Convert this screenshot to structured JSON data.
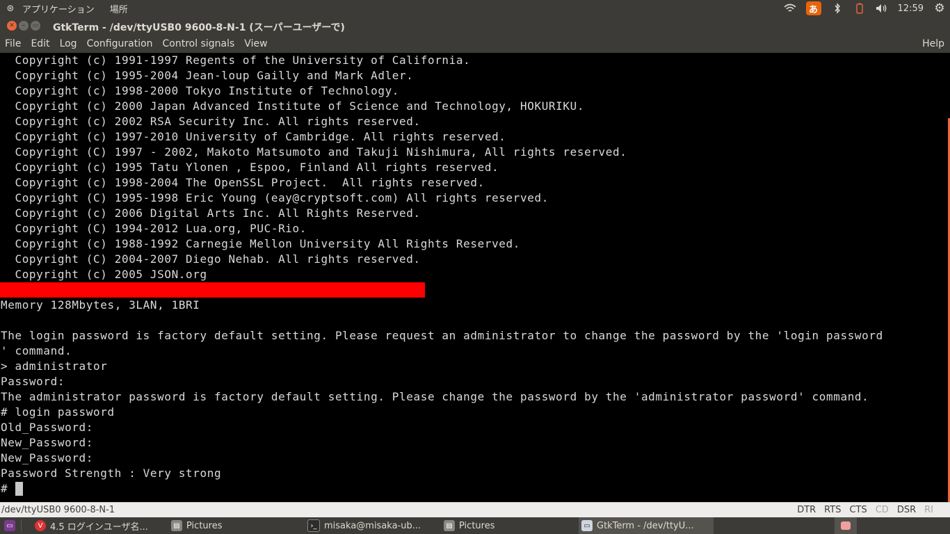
{
  "top_panel": {
    "apps_label": "アプリケーション",
    "places_label": "場所",
    "ime_label": "あ",
    "clock": "12:59"
  },
  "window": {
    "title": "GtkTerm - /dev/ttyUSB0  9600-8-N-1 (スーパーユーザーで)"
  },
  "menu": {
    "items": [
      "File",
      "Edit",
      "Log",
      "Configuration",
      "Control signals",
      "View"
    ],
    "help": "Help"
  },
  "terminal": {
    "lines": [
      "  Copyright (c) 1991-1997 Regents of the University of California.",
      "  Copyright (c) 1995-2004 Jean-loup Gailly and Mark Adler.",
      "  Copyright (c) 1998-2000 Tokyo Institute of Technology.",
      "  Copyright (c) 2000 Japan Advanced Institute of Science and Technology, HOKURIKU.",
      "  Copyright (c) 2002 RSA Security Inc. All rights reserved.",
      "  Copyright (c) 1997-2010 University of Cambridge. All rights reserved.",
      "  Copyright (C) 1997 - 2002, Makoto Matsumoto and Takuji Nishimura, All rights reserved.",
      "  Copyright (c) 1995 Tatu Ylonen , Espoo, Finland All rights reserved.",
      "  Copyright (c) 1998-2004 The OpenSSL Project.  All rights reserved.",
      "  Copyright (C) 1995-1998 Eric Young (eay@cryptsoft.com) All rights reserved.",
      "  Copyright (c) 2006 Digital Arts Inc. All Rights Reserved.",
      "  Copyright (C) 1994-2012 Lua.org, PUC-Rio.",
      "  Copyright (c) 1988-1992 Carnegie Mellon University All Rights Reserved.",
      "  Copyright (C) 2004-2007 Diego Nehab. All rights reserved.",
      "  Copyright (c) 2005 JSON.org",
      "",
      "Memory 128Mbytes, 3LAN, 1BRI",
      "",
      "The login password is factory default setting. Please request an administrator to change the password by the 'login password",
      "' command.",
      "> administrator",
      "Password:",
      "The administrator password is factory default setting. Please change the password by the 'administrator password' command.",
      "# login password",
      "Old_Password:",
      "New_Password:",
      "New_Password:",
      "Password Strength : Very strong",
      "# "
    ]
  },
  "status_bar": {
    "port": "/dev/ttyUSB0  9600-8-N-1",
    "signals": [
      {
        "label": "DTR",
        "active": true
      },
      {
        "label": "RTS",
        "active": true
      },
      {
        "label": "CTS",
        "active": true
      },
      {
        "label": "CD",
        "active": false
      },
      {
        "label": "DSR",
        "active": true
      },
      {
        "label": "RI",
        "active": false
      }
    ]
  },
  "taskbar": {
    "tasks": [
      {
        "label": "4.5 ログインユーザ名..."
      },
      {
        "label": "Pictures"
      },
      {
        "label": "misaka@misaka-ub..."
      },
      {
        "label": "Pictures"
      },
      {
        "label": "GtkTerm - /dev/ttyU..."
      }
    ]
  },
  "colors": {
    "panel_bg": "#3c3b37",
    "terminal_bg": "#000000",
    "terminal_fg": "#dadada",
    "redaction": "#ff0000",
    "ubuntu_orange": "#e9673c"
  }
}
